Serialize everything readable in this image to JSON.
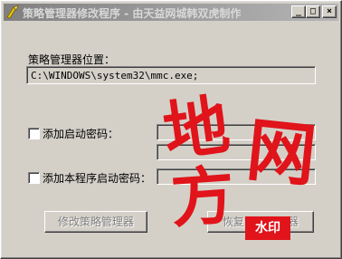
{
  "window": {
    "title": "策略管理器修改程序 - 由天益网城韩双虎制作",
    "controls": {
      "minimize": "_",
      "maximize": "□",
      "close": "×"
    }
  },
  "policy": {
    "location_label": "策略管理器位置：",
    "location_value": "C:\\WINDOWS\\system32\\mmc.exe;"
  },
  "options": {
    "startup_password_label": "添加启动密码：",
    "program_password_label": "添加本程序启动密码："
  },
  "buttons": {
    "modify": "修改策略管理器",
    "restore": "恢复策略管理器"
  },
  "watermark": {
    "chars": [
      "地",
      "网",
      "方"
    ],
    "stamp": "水印",
    "color": "#e0141a"
  }
}
